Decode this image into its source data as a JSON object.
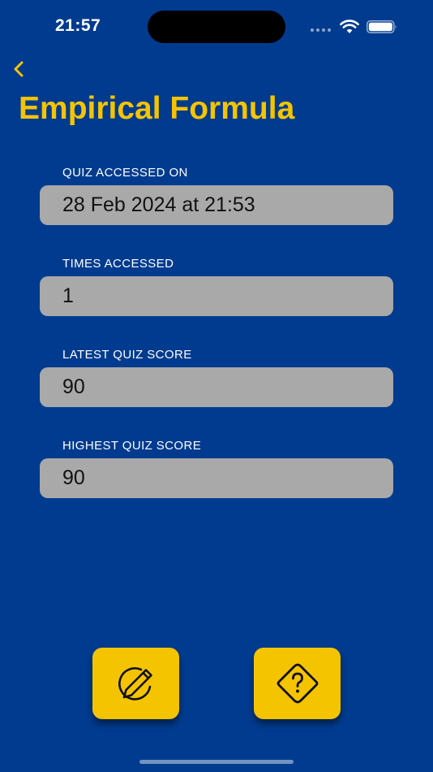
{
  "status_bar": {
    "time": "21:57"
  },
  "header": {
    "back_icon": "chevron-left-icon",
    "title": "Empirical Formula"
  },
  "fields": [
    {
      "label": "QUIZ ACCESSED ON",
      "value": "28 Feb 2024 at 21:53"
    },
    {
      "label": "TIMES ACCESSED",
      "value": "1"
    },
    {
      "label": "LATEST QUIZ SCORE",
      "value": "90"
    },
    {
      "label": "HIGHEST QUIZ SCORE",
      "value": "90"
    }
  ],
  "actions": {
    "edit_icon": "pencil-circle-icon",
    "quiz_icon": "question-diamond-icon"
  },
  "colors": {
    "background": "#003B8F",
    "accent": "#F5C400",
    "field_background": "#A9A9A9"
  }
}
